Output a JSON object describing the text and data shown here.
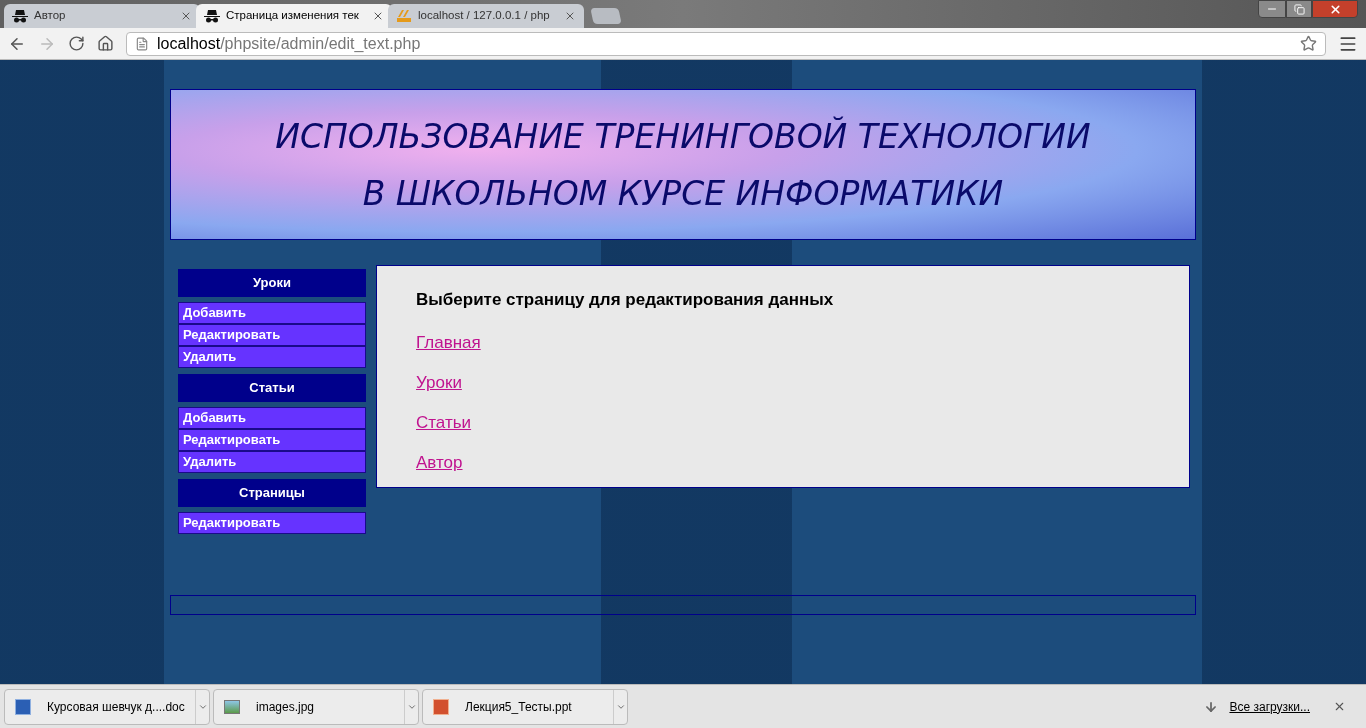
{
  "browser": {
    "tabs": [
      {
        "title": "Автор",
        "kind": "spy",
        "selected": false
      },
      {
        "title": "Страница изменения тек",
        "kind": "spy",
        "selected": true
      },
      {
        "title": "localhost / 127.0.0.1 / php",
        "kind": "pma",
        "selected": false
      }
    ],
    "address": {
      "host": "localhost",
      "path": "/phpsite/admin/edit_text.php"
    }
  },
  "header": {
    "lines": [
      "ИСПОЛЬЗОВАНИЕ ТРЕНИНГОВОЙ ТЕХНОЛОГИИ",
      "В ШКОЛЬНОМ КУРСЕ ИНФОРМАТИКИ"
    ]
  },
  "sidebar": [
    {
      "title": "Уроки",
      "items": [
        "Добавить",
        "Редактировать",
        "Удалить"
      ]
    },
    {
      "title": "Статьи",
      "items": [
        "Добавить",
        "Редактировать",
        "Удалить"
      ]
    },
    {
      "title": "Страницы",
      "items": [
        "Редактировать"
      ]
    }
  ],
  "main": {
    "heading": "Выберите страницу для редактирования данных",
    "links": [
      "Главная",
      "Уроки",
      "Статьи",
      "Автор"
    ]
  },
  "downloads": {
    "items": [
      {
        "name": "Курсовая шевчук д....doc",
        "kind": "word"
      },
      {
        "name": "images.jpg",
        "kind": "image"
      },
      {
        "name": "Лекция5_Тесты.ppt",
        "kind": "powerpoint"
      }
    ],
    "all_link": "Все загрузки..."
  }
}
